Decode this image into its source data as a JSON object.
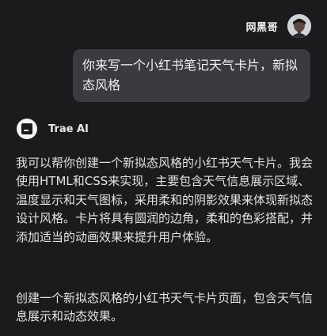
{
  "user": {
    "name": "网黑哥",
    "avatar_icon": "user-avatar"
  },
  "user_message": {
    "text": "你来写一个小红书笔记天气卡片，新拟态风格"
  },
  "ai": {
    "name": "Trae AI",
    "logo_icon": "trae-logo-icon",
    "paragraphs": [
      "我可以帮你创建一个新拟态风格的小红书天气卡片。我会使用HTML和CSS来实现，主要包含天气信息展示区域、温度显示和天气图标，采用柔和的阴影效果来体现新拟态设计风格。卡片将具有圆润的边角，柔和的色彩搭配，并添加适当的动画效果来提升用户体验。",
      "创建一个新拟态风格的小红书天气卡片页面，包含天气信息展示和动态效果。"
    ]
  },
  "colors": {
    "background": "#1b1b1d",
    "bubble": "#3a3b41",
    "text": "#e4e4e6"
  }
}
